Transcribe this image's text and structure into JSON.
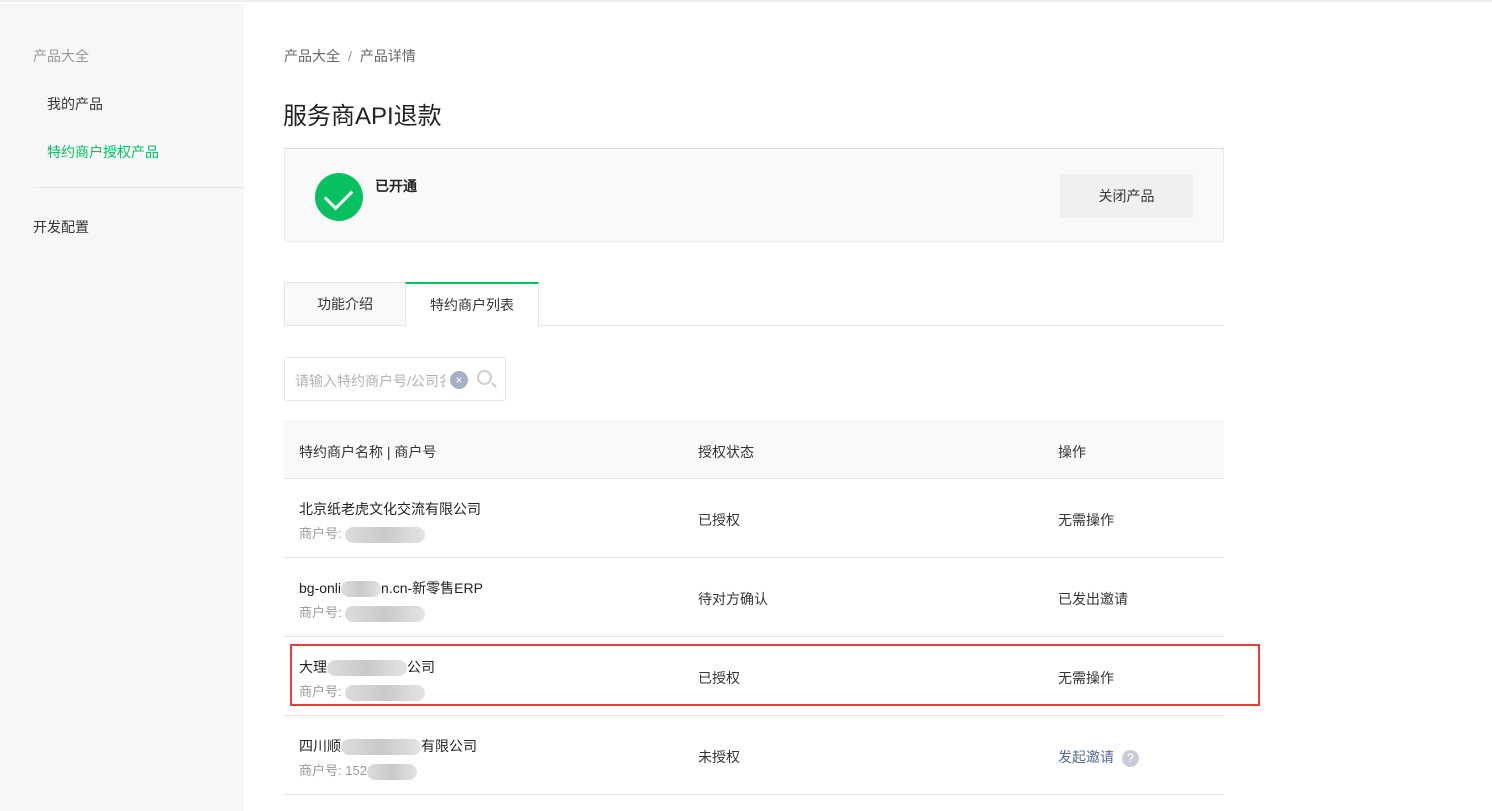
{
  "sidebar": {
    "group": "产品大全",
    "items": [
      {
        "label": "我的产品"
      },
      {
        "label": "特约商户授权产品"
      }
    ],
    "dev": "开发配置"
  },
  "breadcrumb": [
    "产品大全",
    "/",
    "产品详情"
  ],
  "title": "服务商API退款",
  "status": {
    "text": "已开通",
    "close": "关闭产品"
  },
  "tabs": [
    "功能介绍",
    "特约商户列表"
  ],
  "search": {
    "placeholder": "请输入特约商户号/公司名称"
  },
  "table": {
    "headers": [
      "特约商户名称 | 商户号",
      "授权状态",
      "操作"
    ],
    "rows": [
      {
        "name_a": "北京纸老虎文化交流有限公司",
        "name_b": "",
        "mid_label": "商户号:",
        "mid": "",
        "status": "已授权",
        "action": "无需操作"
      },
      {
        "name_a": "bg-onli",
        "name_b": "n.cn-新零售ERP",
        "mid_label": "商户号:",
        "mid": "",
        "status": "待对方确认",
        "action": "已发出邀请"
      },
      {
        "name_a": "大理",
        "name_b": "公司",
        "mid_label": "商户号:",
        "mid": "",
        "status": "已授权",
        "action": "无需操作"
      },
      {
        "name_a": "四川顺",
        "name_b": "有限公司",
        "mid_label": "商户号:",
        "mid": "152",
        "status": "未授权",
        "action": "发起邀请"
      }
    ]
  }
}
